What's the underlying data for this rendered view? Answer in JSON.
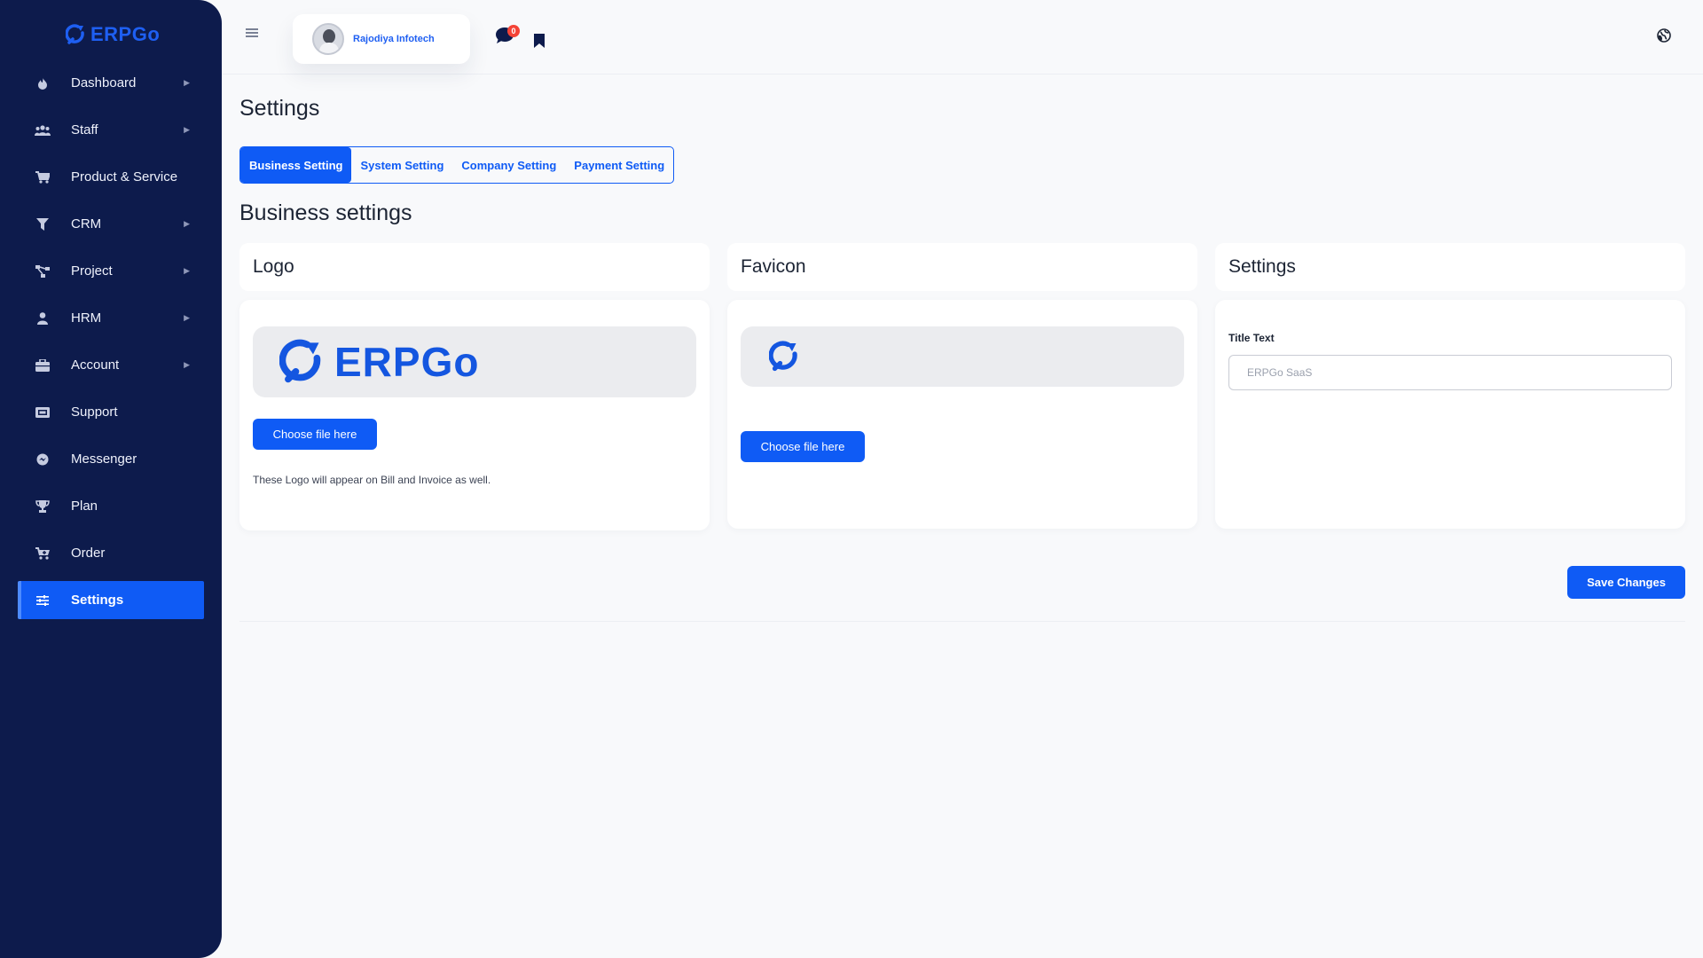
{
  "brand": {
    "name": "ERPGo",
    "accent": "#0f5bf5",
    "sidebar_bg": "#0d1b4c"
  },
  "sidebar": {
    "items": [
      {
        "label": "Dashboard",
        "icon": "fire-icon",
        "has_submenu": true
      },
      {
        "label": "Staff",
        "icon": "users-icon",
        "has_submenu": true
      },
      {
        "label": "Product & Service",
        "icon": "cart-icon",
        "has_submenu": false
      },
      {
        "label": "CRM",
        "icon": "filter-icon",
        "has_submenu": true
      },
      {
        "label": "Project",
        "icon": "share-icon",
        "has_submenu": true
      },
      {
        "label": "HRM",
        "icon": "user-icon",
        "has_submenu": true
      },
      {
        "label": "Account",
        "icon": "briefcase-icon",
        "has_submenu": true
      },
      {
        "label": "Support",
        "icon": "ticket-icon",
        "has_submenu": false
      },
      {
        "label": "Messenger",
        "icon": "messenger-icon",
        "has_submenu": false
      },
      {
        "label": "Plan",
        "icon": "trophy-icon",
        "has_submenu": false
      },
      {
        "label": "Order",
        "icon": "cart-plus-icon",
        "has_submenu": false
      },
      {
        "label": "Settings",
        "icon": "sliders-icon",
        "has_submenu": false,
        "active": true
      }
    ]
  },
  "header": {
    "user_name": "Rajodiya Infotech",
    "message_count": "0"
  },
  "page": {
    "title": "Settings",
    "tabs": [
      {
        "label": "Business Setting",
        "active": true
      },
      {
        "label": "System Setting"
      },
      {
        "label": "Company Setting"
      },
      {
        "label": "Payment Setting"
      }
    ],
    "section_title": "Business settings"
  },
  "cards": {
    "logo": {
      "title": "Logo",
      "logo_text": "ERPGo",
      "button_label": "Choose file here",
      "helper_text": "These Logo will appear on Bill and Invoice as well."
    },
    "favicon": {
      "title": "Favicon",
      "button_label": "Choose file here"
    },
    "settings": {
      "title": "Settings",
      "field_label": "Title Text",
      "field_value": "ERPGo SaaS"
    }
  },
  "actions": {
    "save_label": "Save Changes"
  }
}
